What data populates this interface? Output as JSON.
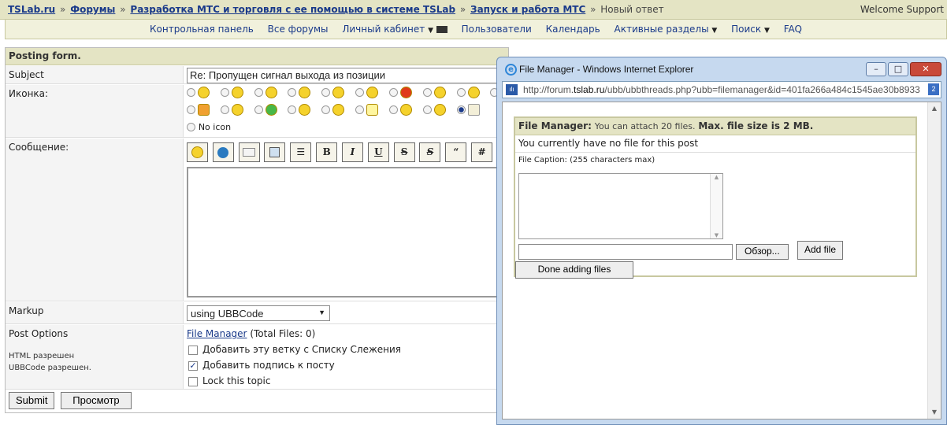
{
  "breadcrumb": {
    "items": [
      "TSLab.ru",
      "Форумы",
      "Разработка МТС и торговля с ее помощью в системе TSLab",
      "Запуск и работа МТС"
    ],
    "separator": "»",
    "current": "Новый ответ",
    "welcome": "Welcome Support"
  },
  "nav": {
    "control_panel": "Контрольная панель",
    "all_forums": "Все форумы",
    "cabinet": "Личный кабинет",
    "users": "Пользователи",
    "calendar": "Календарь",
    "active_topics": "Активные разделы",
    "search": "Поиск",
    "faq": "FAQ"
  },
  "form": {
    "header": "Posting form.",
    "subject_label": "Subject",
    "subject_value": "Re: Пропущен сигнал выхода из позиции",
    "icon_label": "Иконка:",
    "no_icon": "No icon",
    "message_label": "Сообщение:",
    "toolbar": {
      "bold": "B",
      "italic": "I",
      "underline": "U",
      "strike": "S",
      "s2": "S",
      "quote": "“",
      "hash": "#"
    },
    "markup_label": "Markup",
    "markup_value": "using UBBCode",
    "post_options_label": "Post Options",
    "html_status": "HTML разрешен",
    "ubbcode_status": "UBBCode разрешен.",
    "file_manager_link": "File Manager",
    "total_files": "(Total Files: 0)",
    "options": {
      "watch": "Добавить эту ветку с Списку Слежения",
      "signature": "Добавить подпись к посту",
      "lock": "Lock this topic"
    },
    "submit": "Submit",
    "preview": "Просмотр"
  },
  "popup": {
    "title": "File Manager - Windows Internet Explorer",
    "url_prefix": "http://forum.",
    "url_domain": "tslab.ru",
    "url_rest": "/ubb/ubbthreads.php?ubb=filemanager&id=401fa266a484c1545ae30b8933",
    "fm_title": "File Manager:",
    "fm_attach": "You can attach 20 files.",
    "fm_max": "Max. file size is 2 MB.",
    "no_file": "You currently have no file for this post",
    "caption_label": "File Caption: (255 characters max)",
    "browse": "Обзор...",
    "add_file": "Add file",
    "done": "Done adding files"
  }
}
